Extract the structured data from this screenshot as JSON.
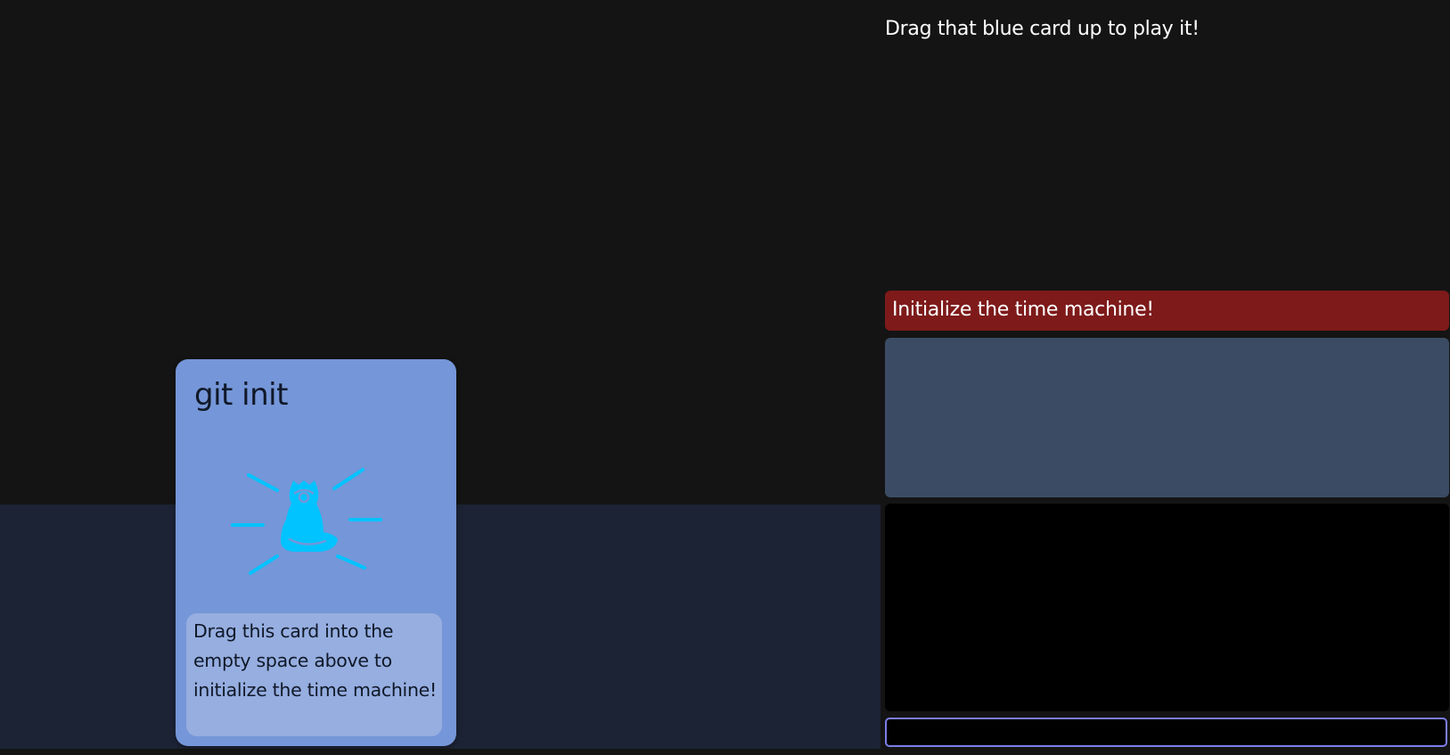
{
  "play_area": {
    "hint": "Drag that blue card up to play it!"
  },
  "hand": {
    "cards": [
      {
        "title": "git init",
        "icon": "time-machine-icon",
        "description": "Drag this card into the empty space above to initialize the time machine!",
        "color": "#7596d8",
        "icon_color": "#00c3ff"
      }
    ]
  },
  "level": {
    "title": "Initialize the time machine!",
    "banner_color": "#7e1a1a"
  },
  "terminal": {
    "input_value": "",
    "input_placeholder": ""
  }
}
